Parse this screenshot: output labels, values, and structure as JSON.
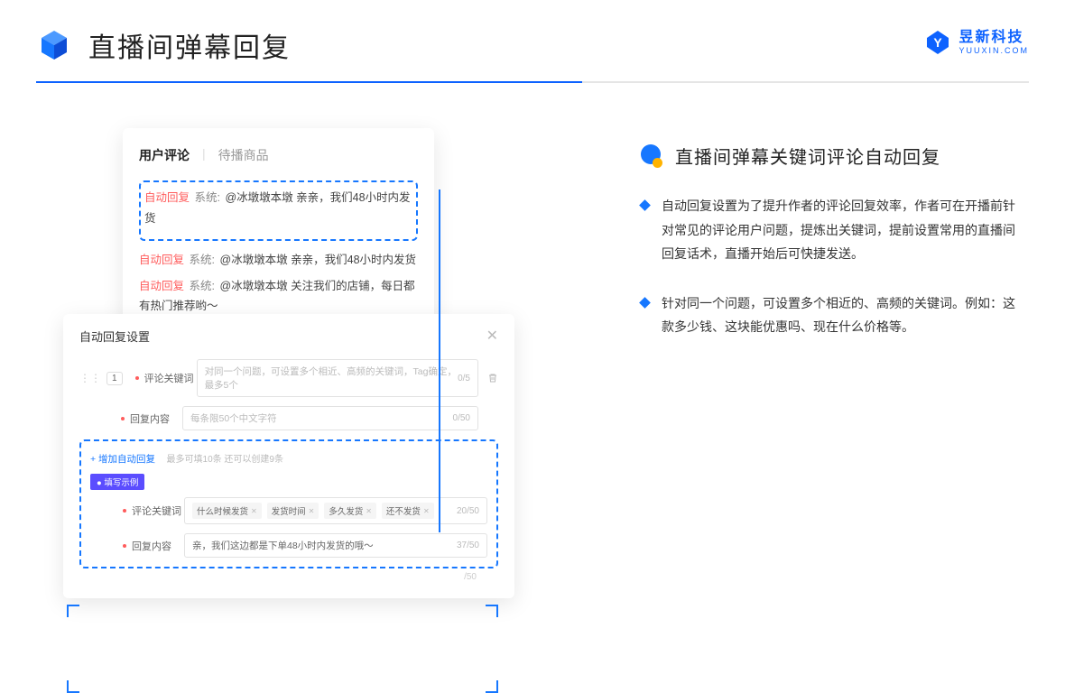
{
  "header": {
    "title": "直播间弹幕回复"
  },
  "brand": {
    "name": "昱新科技",
    "url": "YUUXIN.COM"
  },
  "card1": {
    "tab_active": "用户评论",
    "tab_inactive": "待播商品",
    "msg1_tag": "自动回复",
    "msg1_sys": "系统:",
    "msg1_txt": "@冰墩墩本墩 亲亲，我们48小时内发货",
    "msg2_tag": "自动回复",
    "msg2_sys": "系统:",
    "msg2_txt": "@冰墩墩本墩 亲亲，我们48小时内发货",
    "msg3_tag": "自动回复",
    "msg3_sys": "系统:",
    "msg3_txt": "@冰墩墩本墩 关注我们的店铺，每日都有热门推荐哟～"
  },
  "card2": {
    "title": "自动回复设置",
    "num": "1",
    "row1_label": "评论关键词",
    "row1_placeholder": "对同一个问题，可设置多个相近、高频的关键词，Tag确定，最多5个",
    "row1_counter": "0/5",
    "row2_label": "回复内容",
    "row2_placeholder": "每条限50个中文字符",
    "row2_counter": "0/50",
    "add_link": "+ 增加自动回复",
    "add_hint": "最多可填10条 还可以创建9条",
    "example_pill": "● 填写示例",
    "ex1_label": "评论关键词",
    "ex1_tag1": "什么时候发货",
    "ex1_tag2": "发货时间",
    "ex1_tag3": "多久发货",
    "ex1_tag4": "还不发货",
    "ex1_counter": "20/50",
    "ex2_label": "回复内容",
    "ex2_text": "亲，我们这边都是下单48小时内发货的哦～",
    "ex2_counter": "37/50",
    "bottom_counter": "/50"
  },
  "section": {
    "title": "直播间弹幕关键词评论自动回复",
    "bullet1": "自动回复设置为了提升作者的评论回复效率，作者可在开播前针对常见的评论用户问题，提炼出关键词，提前设置常用的直播间回复话术，直播开始后可快捷发送。",
    "bullet2": "针对同一个问题，可设置多个相近的、高频的关键词。例如：这款多少钱、这块能优惠吗、现在什么价格等。"
  }
}
